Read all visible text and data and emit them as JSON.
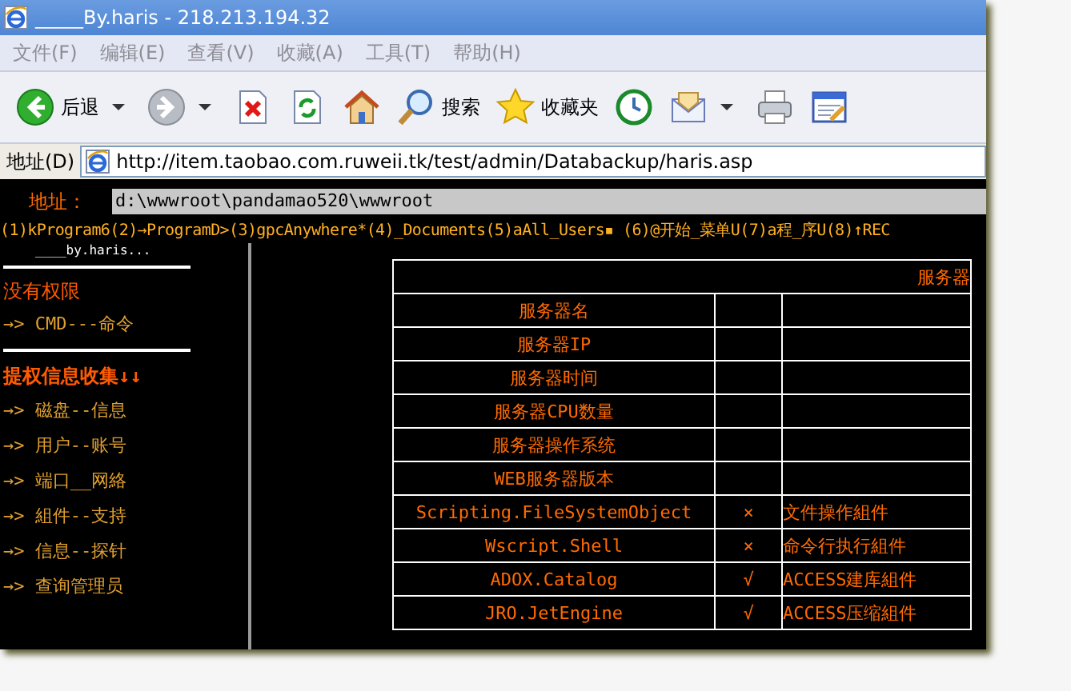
{
  "window": {
    "title": "_____By.haris - 218.213.194.32"
  },
  "menu": [
    "文件(F)",
    "编辑(E)",
    "查看(V)",
    "收藏(A)",
    "工具(T)",
    "帮助(H)"
  ],
  "toolbar": [
    {
      "kind": "back",
      "label": "后退",
      "dropdown": true
    },
    {
      "kind": "forward",
      "dropdown": true
    },
    {
      "kind": "stop"
    },
    {
      "kind": "refresh"
    },
    {
      "kind": "home"
    },
    {
      "kind": "search",
      "label": "搜索"
    },
    {
      "kind": "favorites",
      "label": "收藏夹"
    },
    {
      "kind": "history"
    },
    {
      "kind": "mail",
      "dropdown": true
    },
    {
      "kind": "print"
    },
    {
      "kind": "edit"
    }
  ],
  "address_bar": {
    "label": "地址(D)",
    "value": "http://item.taobao.com.ruweii.tk/test/admin/Databackup/haris.asp"
  },
  "page": {
    "path_label": "地址：",
    "path_value": "d:\\wwwroot\\pandamao520\\wwwroot",
    "quick_paths": "(1)kProgram6(2)→ProgramD>(3)gpcAnywhere*(4)_Documents(5)aAll_Users▪ (6)@开始_菜单U(7)a程_序U(8)↑REC",
    "signature": "____by.haris...",
    "sidebar": [
      {
        "kind": "rule"
      },
      {
        "kind": "note",
        "text": "没有权限"
      },
      {
        "kind": "link",
        "arrow": "→>",
        "text": "CMD---命令"
      },
      {
        "kind": "rule"
      },
      {
        "kind": "heading",
        "text": "提权信息收集↓↓"
      },
      {
        "kind": "link",
        "arrow": "→>",
        "text": "磁盘--信息"
      },
      {
        "kind": "link",
        "arrow": "→>",
        "text": "用户--账号"
      },
      {
        "kind": "link",
        "arrow": "→>",
        "text": "端口__网絡"
      },
      {
        "kind": "link",
        "arrow": "→>",
        "text": "組件--支持"
      },
      {
        "kind": "link",
        "arrow": "→>",
        "text": "信息--探针"
      },
      {
        "kind": "link",
        "arrow": "→>",
        "text": "查询管理员"
      }
    ],
    "table": {
      "title": "服务器",
      "rows": [
        {
          "name": "服务器名"
        },
        {
          "name": "服务器IP"
        },
        {
          "name": "服务器时间"
        },
        {
          "name": "服务器CPU数量"
        },
        {
          "name": "服务器操作系统"
        },
        {
          "name": "WEB服务器版本"
        },
        {
          "name": "Scripting.FileSystemObject",
          "mark": "×",
          "description": "文件操作組件"
        },
        {
          "name": "Wscript.Shell",
          "mark": "×",
          "description": "命令行执行組件"
        },
        {
          "name": "ADOX.Catalog",
          "mark": "√",
          "description": "ACCESS建库組件"
        },
        {
          "name": "JRO.JetEngine",
          "mark": "√",
          "description": "ACCESS压缩組件"
        }
      ]
    }
  }
}
